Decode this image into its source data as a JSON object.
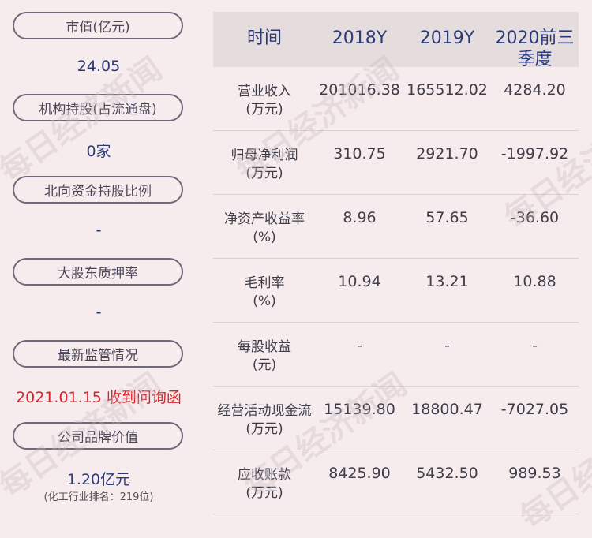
{
  "left": {
    "items": [
      {
        "label": "市值(亿元)",
        "value": "24.05"
      },
      {
        "label": "机构持股(占流通盘)",
        "value": "0家"
      },
      {
        "label": "北向资金持股比例",
        "value": "-"
      },
      {
        "label": "大股东质押率",
        "value": "-"
      },
      {
        "label": "最新监管情况",
        "value": "2021.01.15 收到问询函"
      },
      {
        "label": "公司品牌价值",
        "value": "1.20亿元",
        "note": "(化工行业排名：219位)"
      }
    ]
  },
  "table": {
    "headers": [
      "时间",
      "2018Y",
      "2019Y",
      "2020前三季度"
    ],
    "rows": [
      {
        "label": [
          "营业收入",
          "(万元)"
        ],
        "values": [
          "201016.38",
          "165512.02",
          "4284.20"
        ]
      },
      {
        "label": [
          "归母净利润",
          "(万元)"
        ],
        "values": [
          "310.75",
          "2921.70",
          "-1997.92"
        ]
      },
      {
        "label": [
          "净资产收益率",
          "(%)"
        ],
        "values": [
          "8.96",
          "57.65",
          "-36.60"
        ]
      },
      {
        "label": [
          "毛利率",
          "(%)"
        ],
        "values": [
          "10.94",
          "13.21",
          "10.88"
        ]
      },
      {
        "label": [
          "每股收益",
          "(元)"
        ],
        "values": [
          "-",
          "-",
          "-"
        ]
      },
      {
        "label": [
          "经营活动现金流",
          "(万元)"
        ],
        "values": [
          "15139.80",
          "18800.47",
          "-7027.05"
        ]
      },
      {
        "label": [
          "应收账款",
          "(万元)"
        ],
        "values": [
          "8425.90",
          "5432.50",
          "989.53"
        ]
      }
    ]
  },
  "watermark": "每日经济新闻"
}
